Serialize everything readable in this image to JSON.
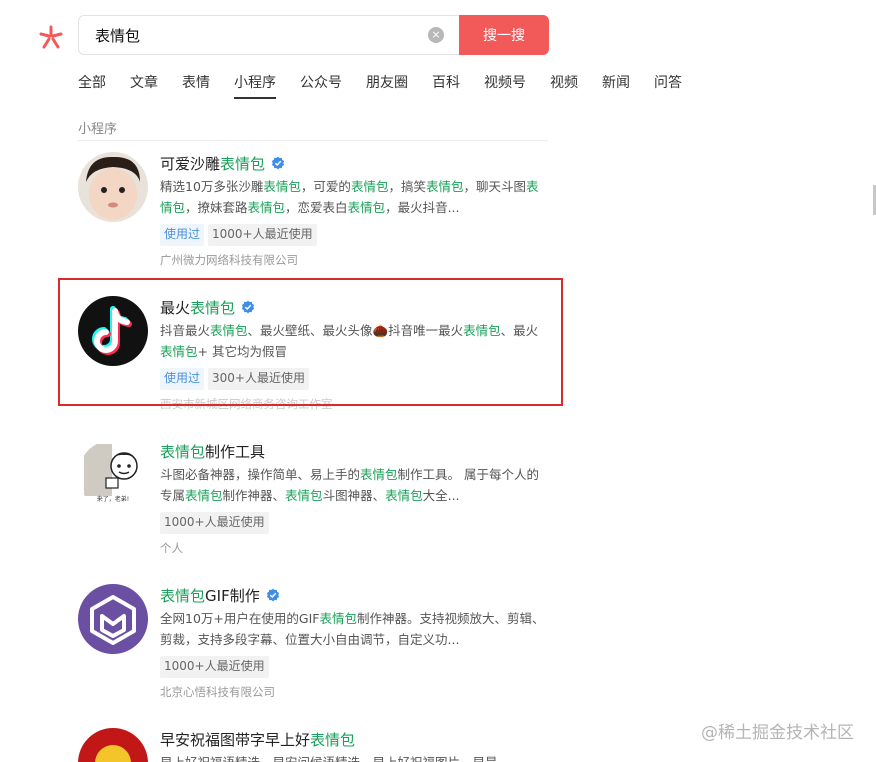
{
  "search": {
    "query": "表情包",
    "button_label": "搜一搜",
    "clear_glyph": "×"
  },
  "tabs": [
    {
      "label": "全部"
    },
    {
      "label": "文章"
    },
    {
      "label": "表情"
    },
    {
      "label": "小程序",
      "active": true
    },
    {
      "label": "公众号"
    },
    {
      "label": "朋友圈"
    },
    {
      "label": "百科"
    },
    {
      "label": "视频号"
    },
    {
      "label": "视频"
    },
    {
      "label": "新闻"
    },
    {
      "label": "问答"
    }
  ],
  "section_title": "小程序",
  "results": [
    {
      "title_pre": "可爱沙雕",
      "title_hl": "表情包",
      "title_post": "",
      "verified": true,
      "desc_html": "精选10万多张沙雕<b>表情包</b>，可爱的<b>表情包</b>，搞笑<b>表情包</b>，聊天斗图<b>表情包</b>，撩妹套路<b>表情包</b>，恋爱表白<b>表情包</b>，最火抖音...",
      "tags": [
        {
          "label": "使用过",
          "used": true
        },
        {
          "label": "1000+人最近使用"
        }
      ],
      "company": "广州微力网络科技有限公司",
      "avatar": "baby-face"
    },
    {
      "title_pre": "最火",
      "title_hl": "表情包",
      "title_post": "",
      "verified": true,
      "desc_html": "抖音最火<b>表情包</b>、最火壁纸、最火头像🌰抖音唯一最火<b>表情包</b>、最火<b>表情包</b>+ 其它均为假冒",
      "tags": [
        {
          "label": "使用过",
          "used": true
        },
        {
          "label": "300+人最近使用"
        }
      ],
      "company": "西安市新城区网络商务咨询工作室",
      "avatar": "tiktok"
    },
    {
      "title_pre": "",
      "title_hl": "表情包",
      "title_post": "制作工具",
      "verified": false,
      "desc_html": "斗图必备神器，操作简单、易上手的<b>表情包</b>制作工具。 属于每个人的专属<b>表情包</b>制作神器、<b>表情包</b>斗图神器、<b>表情包</b>大全...",
      "tags": [
        {
          "label": "1000+人最近使用"
        }
      ],
      "company": "个人",
      "avatar": "meme",
      "avatar_caption": "来了，老弟!"
    },
    {
      "title_pre": "",
      "title_hl": "表情包",
      "title_post": "GIF制作",
      "verified": true,
      "desc_html": "全网10万+用户在使用的GIF<b>表情包</b>制作神器。支持视频放大、剪辑、剪裁，支持多段字幕、位置大小自由调节，自定义功...",
      "tags": [
        {
          "label": "1000+人最近使用"
        }
      ],
      "company": "北京心悟科技有限公司",
      "avatar": "gif-maker"
    },
    {
      "title_pre": "早安祝福图带字早上好",
      "title_hl": "表情包",
      "title_post": "",
      "verified": false,
      "desc_html": "早上好祝福语精选、早安问候语精选、早上好祝福图片、早是...",
      "tags": [],
      "company": "",
      "avatar": "morning"
    }
  ],
  "watermark": "@稀土掘金技术社区",
  "colors": {
    "accent": "#f25a5a",
    "highlight_text": "#18a058",
    "verified": "#3d8ee8",
    "box": "#d62c2c"
  }
}
